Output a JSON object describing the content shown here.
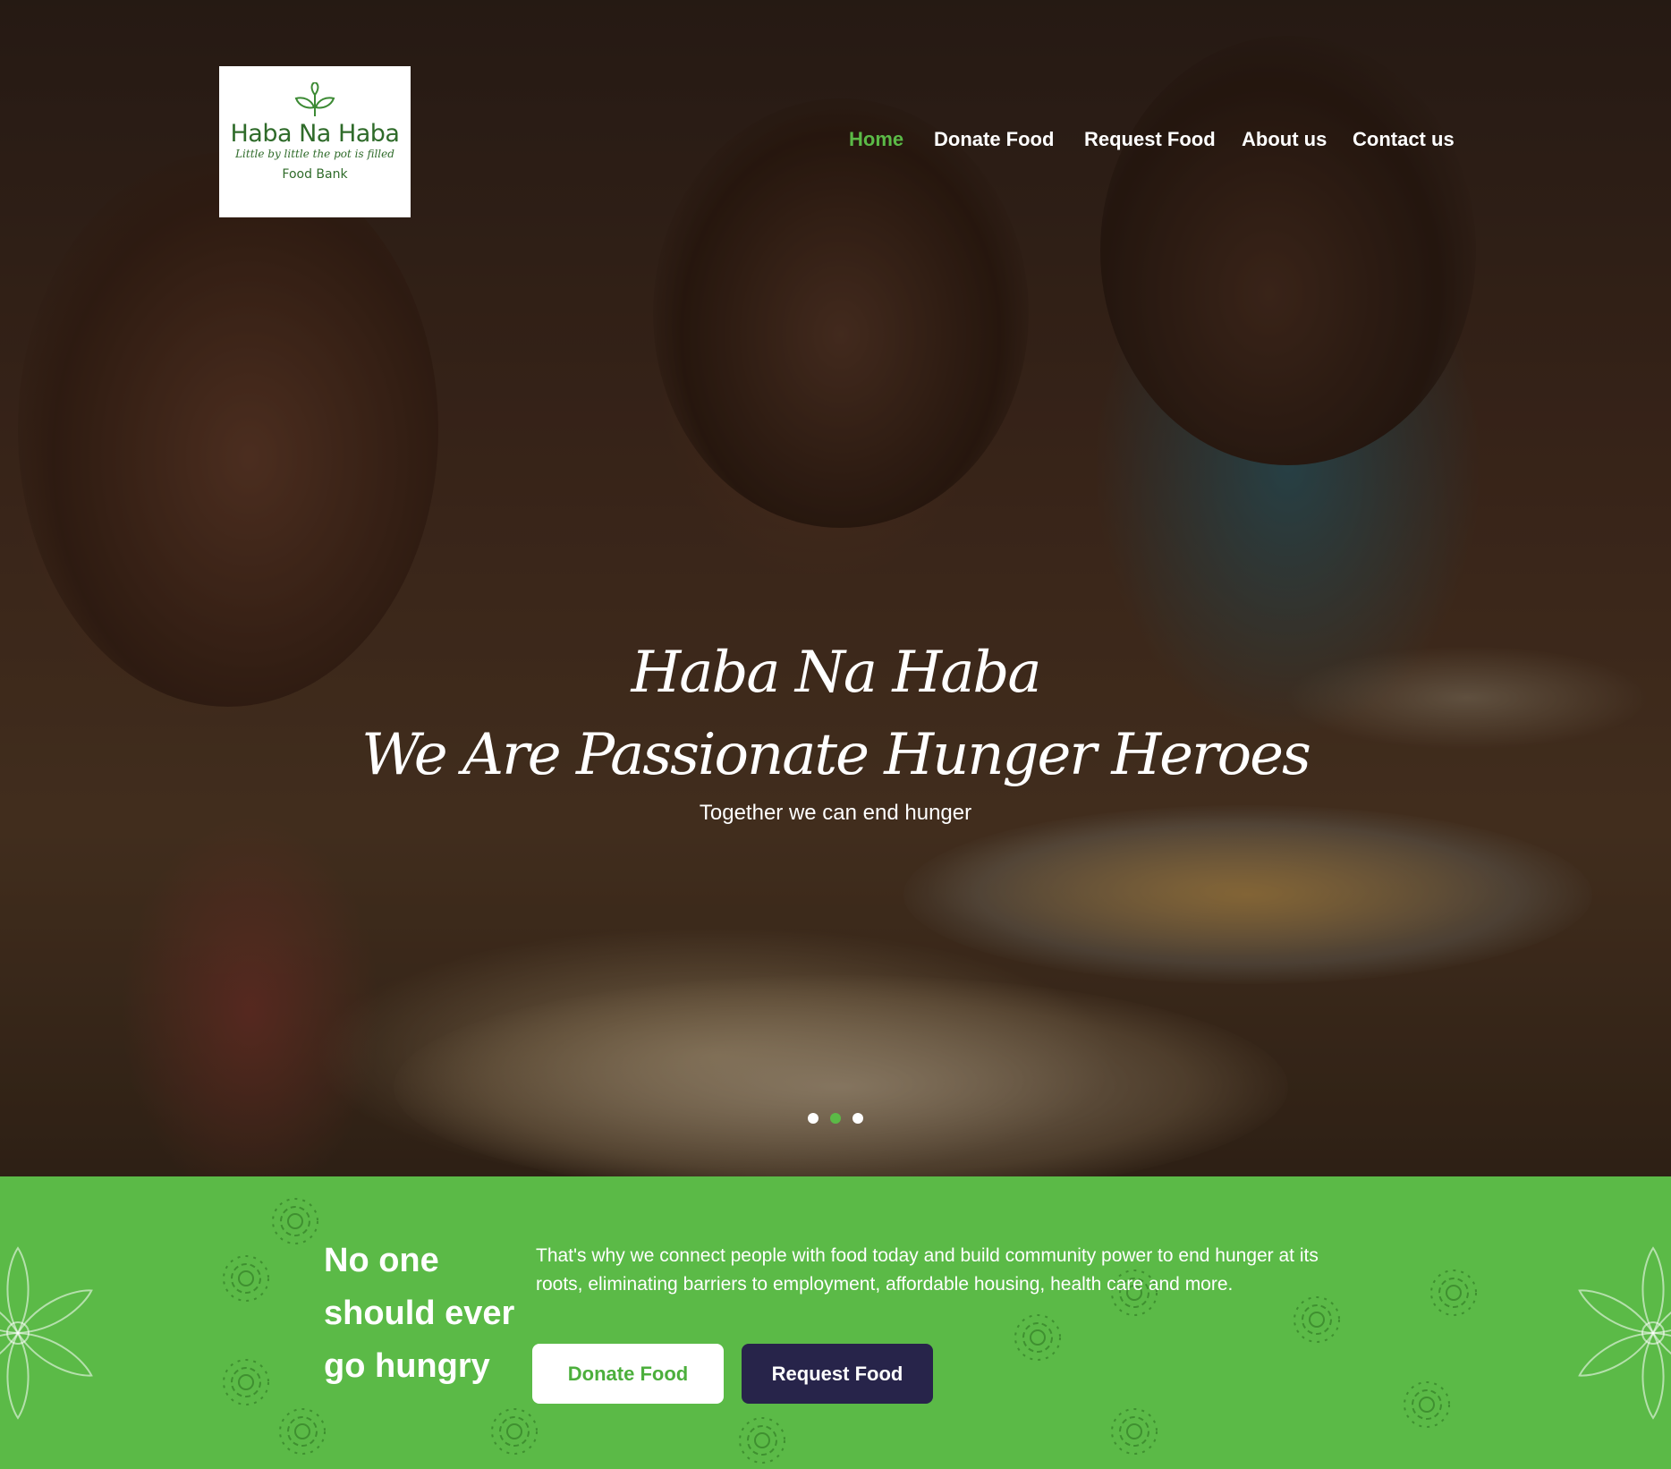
{
  "logo": {
    "title": "Haba Na Haba",
    "tagline": "Little by little the pot is filled",
    "subtitle": "Food Bank"
  },
  "nav": {
    "items": [
      {
        "label": "Home",
        "active": true
      },
      {
        "label": "Donate Food",
        "active": false
      },
      {
        "label": "Request Food",
        "active": false
      },
      {
        "label": "About us",
        "active": false
      },
      {
        "label": "Contact us",
        "active": false
      }
    ]
  },
  "hero": {
    "title_line1": "Haba Na Haba",
    "title_line2": "We Are Passionate Hunger Heroes",
    "subtitle": "Together we can end hunger",
    "slides": 3,
    "active_slide": 2
  },
  "band": {
    "heading": [
      "No one",
      "should ever",
      "go hungry"
    ],
    "text": "That's why we connect people with food today and build community power to end hunger at its roots, eliminating barriers to employment, affordable housing, health care and more.",
    "donate_label": "Donate Food",
    "request_label": "Request Food"
  },
  "colors": {
    "brand_green": "#5bba47",
    "dark_navy": "#27244a",
    "logo_green": "#2f6b2a"
  }
}
